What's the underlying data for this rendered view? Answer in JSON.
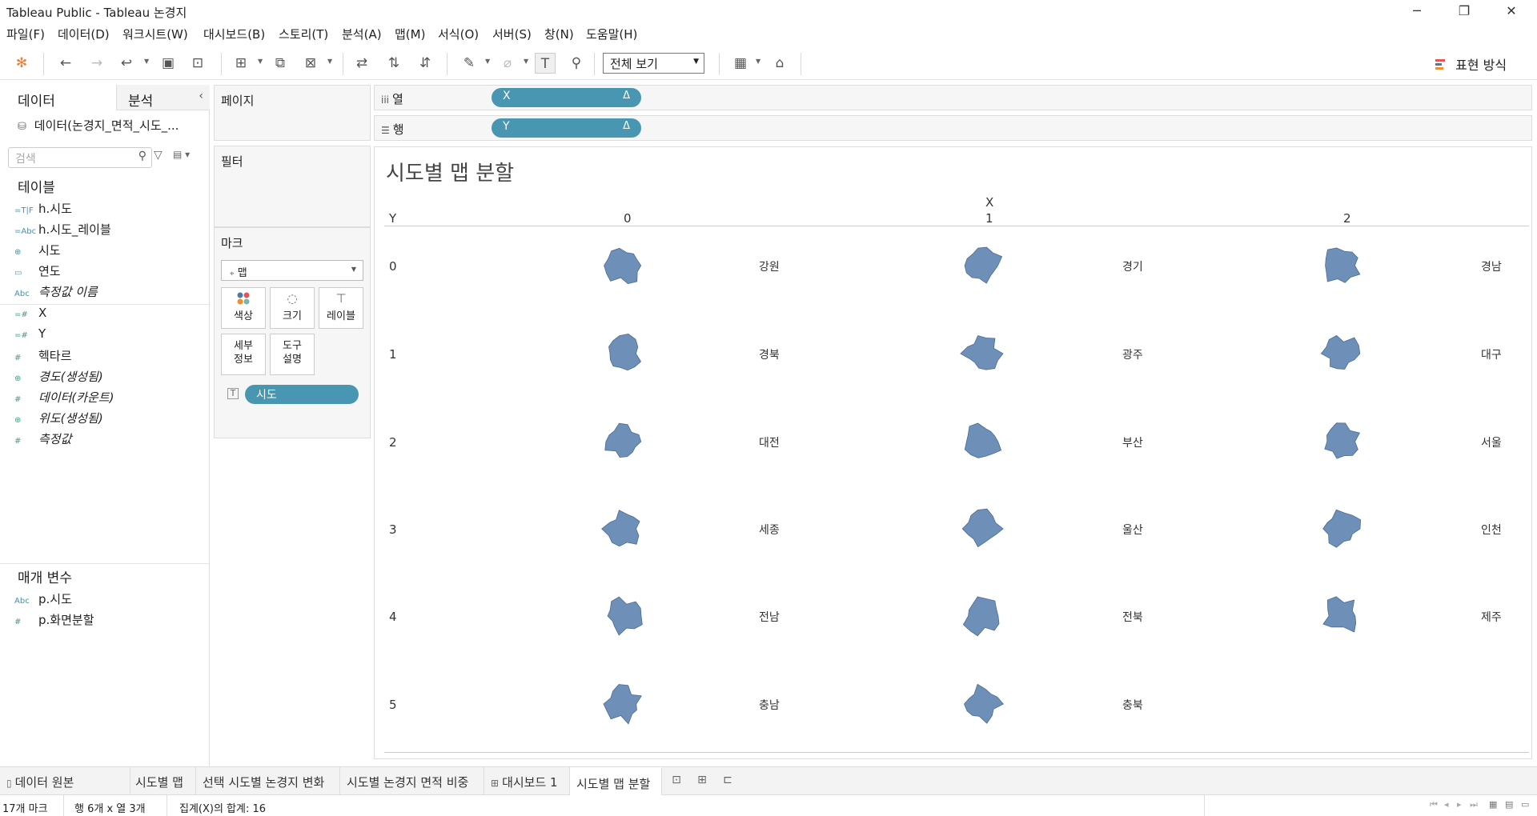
{
  "window": {
    "title": "Tableau Public - Tableau 논경지"
  },
  "menu": [
    "파일(F)",
    "데이터(D)",
    "워크시트(W)",
    "대시보드(B)",
    "스토리(T)",
    "분석(A)",
    "맵(M)",
    "서식(O)",
    "서버(S)",
    "창(N)",
    "도움말(H)"
  ],
  "toolbar": {
    "fit_value": "전체 보기",
    "show_me": "표현 방식"
  },
  "data_pane": {
    "tab_data": "데이터",
    "tab_analysis": "분석",
    "datasource": "데이터(논경지_면적_시도_...",
    "search_placeholder": "검색",
    "tables_header": "테이블",
    "dimensions": [
      {
        "icon": "=T|F",
        "name": "h.시도"
      },
      {
        "icon": "=Abc",
        "name": "h.시도_레이블"
      },
      {
        "icon": "⊕",
        "name": "시도"
      },
      {
        "icon": "▭",
        "name": "연도"
      },
      {
        "icon": "Abc",
        "name": "측정값 이름"
      }
    ],
    "measures": [
      {
        "icon": "=#",
        "name": "X"
      },
      {
        "icon": "=#",
        "name": "Y"
      },
      {
        "icon": "#",
        "name": "헥타르"
      },
      {
        "icon": "⊕",
        "name": "경도(생성됨)"
      },
      {
        "icon": "#",
        "name": "데이터(카운트)"
      },
      {
        "icon": "⊕",
        "name": "위도(생성됨)"
      },
      {
        "icon": "#",
        "name": "측정값"
      }
    ],
    "params_header": "매개 변수",
    "params": [
      {
        "icon": "Abc",
        "name": "p.시도"
      },
      {
        "icon": "#",
        "name": "p.화면분할"
      }
    ]
  },
  "cards": {
    "pages": "페이지",
    "filters": "필터",
    "marks": "마크",
    "mark_type": "맵",
    "buttons": {
      "color": "색상",
      "size": "크기",
      "label": "레이블",
      "detail_1": "세부",
      "detail_2": "정보",
      "tooltip_1": "도구",
      "tooltip_2": "설명"
    },
    "mark_pill": "시도"
  },
  "shelves": {
    "columns_label": "열",
    "rows_label": "행",
    "columns_pill": "X",
    "rows_pill": "Y",
    "delta": "Δ"
  },
  "viz": {
    "title": "시도별 맵 분할",
    "x_header": "X",
    "y_header": "Y",
    "x_ticks": [
      "0",
      "1",
      "2"
    ],
    "y_ticks": [
      "0",
      "1",
      "2",
      "3",
      "4",
      "5"
    ],
    "regions": [
      [
        "강원",
        "경기",
        "경남"
      ],
      [
        "경북",
        "광주",
        "대구"
      ],
      [
        "대전",
        "부산",
        "서울"
      ],
      [
        "세종",
        "울산",
        "인천"
      ],
      [
        "전남",
        "전북",
        "제주"
      ],
      [
        "충남",
        "충북",
        ""
      ]
    ],
    "fill_color": "#6e90b8"
  },
  "sheet_tabs": [
    {
      "name": "데이터 원본",
      "icon": "▯"
    },
    {
      "name": "시도별 맵",
      "icon": ""
    },
    {
      "name": "선택 시도별 논경지 변화",
      "icon": ""
    },
    {
      "name": "시도별 논경지 면적 비중",
      "icon": ""
    },
    {
      "name": "대시보드 1",
      "icon": "⊞"
    },
    {
      "name": "시도별 맵 분할",
      "icon": ""
    }
  ],
  "status": {
    "marks": "17개 마크",
    "rows_cols": "행 6개 x 열 3개",
    "sum": "집계(X)의 합계: 16"
  }
}
